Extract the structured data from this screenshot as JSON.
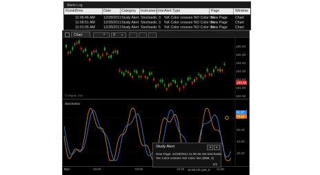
{
  "alerts_log": {
    "title": "Alerts Log",
    "columns": [
      "Rundo",
      "Time",
      "Date",
      "Category",
      "Instrument",
      "Inte",
      "Alert Type",
      "Page",
      "Window"
    ],
    "rows": [
      [
        "",
        "11:06:46 AM",
        "12/28/2011",
        "Study Alert",
        "Stochastic",
        "3",
        "%K Color crosses %D Color line",
        "New Page",
        "Chart"
      ],
      [
        "",
        "11:06:51 AM",
        "12/28/2011",
        "Study Alert",
        "Stochastic",
        "3",
        "%K Color crosses %D Color line",
        "New Page",
        "Chart"
      ],
      [
        "",
        "11:01:05 AM",
        "12/28/2011",
        "Study Alert",
        "Stochastic",
        "5",
        "%K Color crosses %D Color line",
        "New Page",
        "Chart"
      ]
    ]
  },
  "chart_window": {
    "tab_label": "Chart",
    "interval_value": "3",
    "watermark": "© eSignal, 2011",
    "oscillator_label": "Stochastic",
    "price_axis_labels": [
      "185.50",
      "185.00",
      "184.50",
      "184.00",
      "183.50",
      "183.00",
      "182.50"
    ],
    "price_last_label": "183.48",
    "osc_axis_labels": [
      "80.00",
      "60.00",
      "40.00",
      "20.00"
    ],
    "osc_k_label": "81.67",
    "osc_d_label": "76.24",
    "time_labels": [
      "08:00",
      "09:00",
      "10:00",
      "11:00"
    ],
    "corner_label": "Dyn",
    "colors": {
      "bull_candle": "#1aa81a",
      "bear_candle": "#e01a1a",
      "k_line": "#e07a16",
      "d_line": "#2f7de0",
      "price_highlight": "#e02020",
      "osc_highlight": "#2f7de0"
    }
  },
  "study_alert_popup": {
    "title": "Study Alert",
    "line1": "New Page: 12/28/2011 11:06:46 AM Stochastic",
    "line2": "%K Color crosses %D Color line (BB8, 3)",
    "count": "5/5",
    "nav_prev": "◂",
    "nav_next": "▸"
  },
  "status_clock": "11:06:1/5 (asl_0"
}
